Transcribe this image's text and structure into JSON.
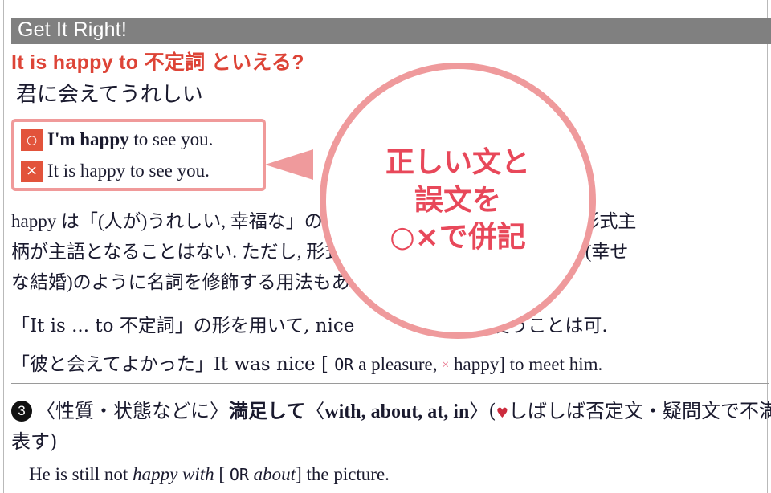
{
  "section": {
    "bar_label": "Get It Right!",
    "bar_color": "#808080"
  },
  "headline": {
    "text": "It is happy to 不定詞 といえる?",
    "color": "#dd4437"
  },
  "gloss": "君に会えてうれしい",
  "example_box": {
    "border_color": "#f09a9a",
    "rows": [
      {
        "badge": "circle-ok-icon",
        "badge_glyph": "○",
        "bold_part": "I'm happy",
        "rest": " to see you."
      },
      {
        "badge": "cross-ng-icon",
        "badge_glyph": "×",
        "bold_part": "",
        "rest": "It is happy to see you."
      }
    ]
  },
  "bubble": {
    "color": "#ef9a9c",
    "text_color": "#e8485a",
    "lines": [
      "正しい文と",
      "誤文を",
      "○×で併記"
    ]
  },
  "body_lines": [
    "happy は「(人が)うれしい, 幸福な」の意味で, 主語には「人」がくる. 形式主",
    "柄が主語となることはない. ただし, 形式主語(→文末), a happy marriage(幸せ",
    "な結婚)のように名詞を修飾する用法もある."
  ],
  "note_lines": {
    "line1_pre": "「It is ... to 不定詞」の形を用いて, nice",
    "line1_post": "使うことは可.",
    "line2_pre": "「彼と会えてよかった」It was nice [ ",
    "line2_or": "OR",
    "line2_mid": " a pleasure, ",
    "line2_x": "×",
    "line2_post": " happy] to meet him."
  },
  "sense": {
    "number": "3",
    "head_jp": "〈性質・状態などに〉",
    "head_jp_bold": "満足して",
    "bracket_open": "〈",
    "prepositions": "with, about, at, in",
    "bracket_close": "〉",
    "note_open": "(",
    "heart": "♥",
    "note_jp": "しばしば否定文・疑問文で不満を",
    "continuation": "表す)"
  },
  "example_sentence": {
    "pre": "He is still not ",
    "italic1": "happy with",
    "mid": " [ ",
    "or": "OR",
    "italic2": "about",
    "post": "] the picture."
  }
}
